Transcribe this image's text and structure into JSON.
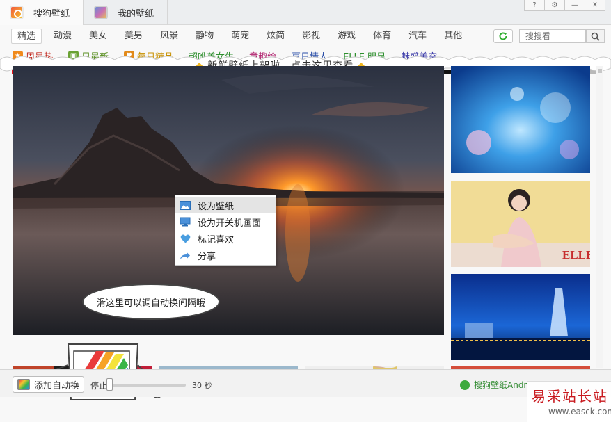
{
  "tabs": [
    {
      "label": "搜狗壁纸",
      "icon": "sogou-logo-icon",
      "active": true
    },
    {
      "label": "我的壁纸",
      "icon": "my-wallpaper-icon",
      "active": false
    }
  ],
  "window_buttons": [
    {
      "label": "?",
      "icon": "help-icon"
    },
    {
      "label": "⚙",
      "icon": "settings-icon"
    },
    {
      "label": "—",
      "icon": "minimize-icon"
    },
    {
      "label": "✕",
      "icon": "close-icon"
    }
  ],
  "categories": [
    "精选",
    "动漫",
    "美女",
    "美男",
    "风景",
    "静物",
    "萌宠",
    "炫简",
    "影视",
    "游戏",
    "体育",
    "汽车",
    "其他"
  ],
  "active_category": "精选",
  "search": {
    "placeholder": "搜搜看"
  },
  "tags": [
    {
      "label": "周最热",
      "color": "#c0261c",
      "icon": "star-icon",
      "icon_color": "#f08a1c",
      "glyph": "★"
    },
    {
      "label": "日最新",
      "color": "#5a8f22",
      "icon": "picture-icon",
      "icon_color": "#6aa234",
      "glyph": "▣"
    },
    {
      "label": "每日精品",
      "color": "#c79000",
      "icon": "heart-icon",
      "icon_color": "#e28a1a",
      "glyph": "♥"
    },
    {
      "label": "超唯美女生",
      "color": "#2e8f2e",
      "icon": "",
      "icon_color": "",
      "glyph": ""
    },
    {
      "label": "童趣绘",
      "color": "#b0206d",
      "icon": "",
      "icon_color": "",
      "glyph": ""
    },
    {
      "label": "夏日情人",
      "color": "#2a4ea8",
      "icon": "",
      "icon_color": "",
      "glyph": ""
    },
    {
      "label": "ELLE 明星",
      "color": "#2e8f2e",
      "icon": "",
      "icon_color": "",
      "glyph": ""
    },
    {
      "label": "魅惑美空",
      "color": "#3a3aa8",
      "icon": "",
      "icon_color": "",
      "glyph": ""
    }
  ],
  "color_filters": [
    "#e8141b",
    "#f7b12a",
    "#f7ec1b",
    "#1ea04a",
    "#1a9bd7",
    "#7030a0",
    "#f274a8",
    "#8b3a12",
    "#111111",
    "#ffffff",
    "#b8b8b8"
  ],
  "banner": {
    "text": "新鲜壁纸上架啦，点击这里查看"
  },
  "context_menu": [
    {
      "label": "设为壁纸",
      "icon": "wallpaper-icon",
      "hover": true
    },
    {
      "label": "设为开关机画面",
      "icon": "monitor-icon",
      "hover": false
    },
    {
      "label": "标记喜欢",
      "icon": "heart-icon",
      "hover": false
    },
    {
      "label": "分享",
      "icon": "share-icon",
      "hover": false
    }
  ],
  "thumbnails": [
    {
      "name": "thumb-blue-bokeh"
    },
    {
      "name": "thumb-woman-elle",
      "overlay": "ELLE"
    },
    {
      "name": "thumb-dubai-night"
    },
    {
      "name": "thumb-colorful-1"
    },
    {
      "name": "thumb-coastal-city"
    },
    {
      "name": "thumb-man-portrait"
    },
    {
      "name": "thumb-teddy-bear"
    }
  ],
  "mascot_hint": "滑这里可以调自动换间隔哦",
  "bottom": {
    "auto_switch_label": "添加自动换",
    "stop_label": "停止",
    "interval": 0.0,
    "seconds_label": "30 秒",
    "android_label": "搜狗壁纸Andr"
  },
  "watermark": {
    "title": "易采站长站",
    "url": "www.easck.com"
  }
}
